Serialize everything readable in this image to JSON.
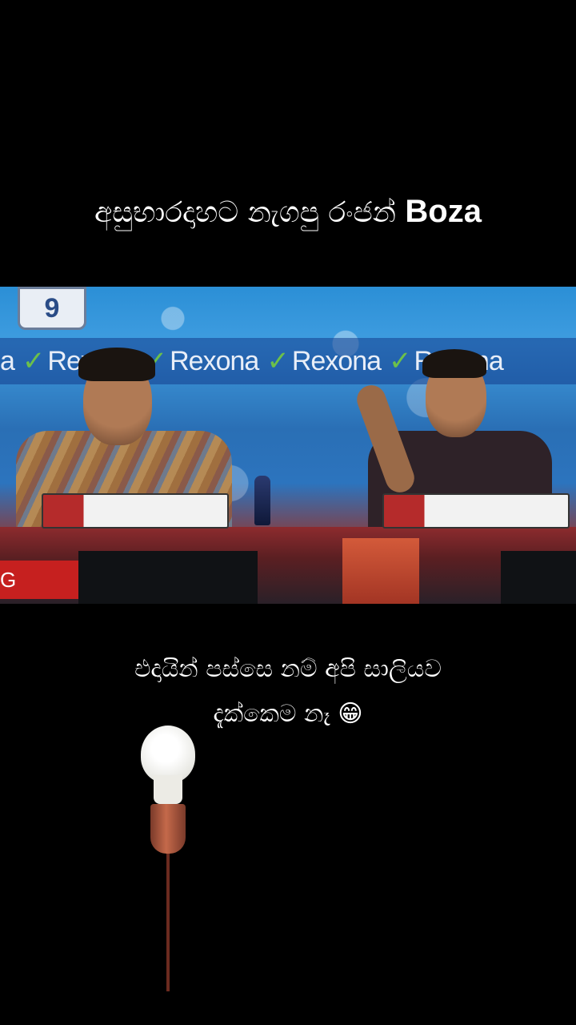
{
  "post": {
    "title_text": "අසුභාරදාහට නැගපු රංජන් ",
    "title_brand": "Boza",
    "caption_line1": "එදායින් පස්සෙ නම් අපි සාලියව",
    "caption_line2": "දැක්කෙම නෑ 😁"
  },
  "video": {
    "channel_number": "9",
    "sponsor_words": [
      "a",
      "Rexona",
      "Rexona",
      "Rexona",
      "Rexona"
    ],
    "ticker_text": "G NEWS"
  },
  "colors": {
    "background": "#000000",
    "text": "#ffffff",
    "ticker_red": "#c6201f"
  },
  "icons": {
    "lamp": "light-bulb-icon"
  }
}
